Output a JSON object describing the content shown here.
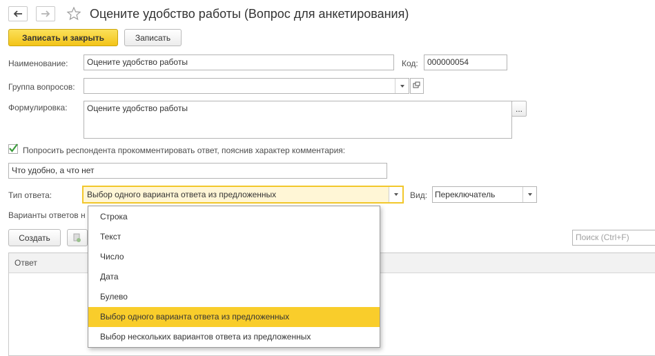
{
  "window": {
    "title": "Оцените удобство работы (Вопрос для анкетирования)",
    "back_icon": "arrow-left-icon",
    "forward_icon": "arrow-right-icon",
    "favorite_icon": "star-icon"
  },
  "toolbar": {
    "save_close_label": "Записать и закрыть",
    "save_label": "Записать"
  },
  "form": {
    "name_label": "Наименование:",
    "name_value": "Оцените удобство работы",
    "code_label": "Код:",
    "code_value": "000000054",
    "group_label": "Группа вопросов:",
    "group_value": "",
    "wording_label": "Формулировка:",
    "wording_value": "Оцените удобство работы",
    "wording_button": "...",
    "comment_checkbox_checked": true,
    "comment_checkbox_label": "Попросить респондента прокомментировать ответ, пояснив характер комментария:",
    "comment_value": "Что удобно, а что нет",
    "answer_type_label": "Тип ответа:",
    "answer_type_value": "Выбор одного варианта ответа из предложенных",
    "view_label": "Вид:",
    "view_value": "Переключатель",
    "variants_label": "Варианты ответов на вопрос:",
    "create_label": "Создать",
    "search_placeholder": "Поиск (Ctrl+F)",
    "table_header_answer": "Ответ"
  },
  "dropdown": {
    "items": [
      "Строка",
      "Текст",
      "Число",
      "Дата",
      "Булево",
      "Выбор одного варианта ответа из предложенных",
      "Выбор нескольких вариантов ответа из предложенных"
    ],
    "selected_index": 5
  },
  "colors": {
    "accent": "#f9cd2b",
    "primary_button": "#f5cb2a",
    "checkbox_green": "#3b9b3b"
  }
}
